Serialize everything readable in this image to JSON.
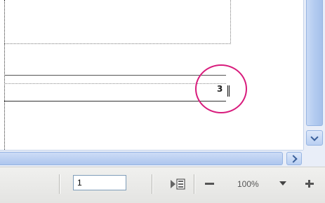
{
  "document": {
    "page_number_field": "3"
  },
  "status_bar": {
    "page_input_value": "1",
    "zoom_level": "100%"
  },
  "colors": {
    "highlight_circle": "#d81b7c",
    "scrollbar": "#b3cbf0",
    "status_bar": "#ececea"
  },
  "icons": {
    "vertical_scroll_down": "chevron-down-icon",
    "horizontal_scroll_right": "chevron-right-icon",
    "go_to_page": "go-to-page-icon",
    "zoom_out": "minus-icon",
    "zoom_dropdown": "caret-down-icon",
    "zoom_in": "plus-icon"
  }
}
